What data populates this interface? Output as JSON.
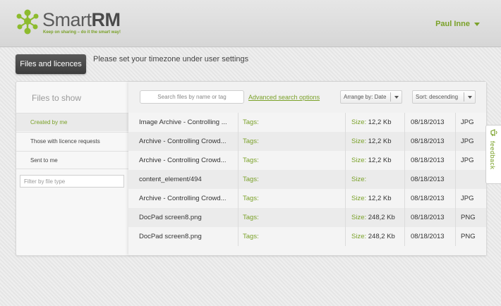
{
  "brand": {
    "name_part1": "Smart",
    "name_part2": "RM",
    "tagline": "Keep on sharing – do it the smart way!",
    "accent_color": "#7aa128"
  },
  "header": {
    "user_name": "Paul Inne"
  },
  "top_button": "Files and licences",
  "notice": "Please set your timezone under user settings",
  "sidebar": {
    "title": "Files to show",
    "items": [
      {
        "label": "Created by me",
        "active": true
      },
      {
        "label": "Those with licence requests",
        "active": false
      },
      {
        "label": "Sent to me",
        "active": false
      }
    ],
    "filter_placeholder": "Filter by file type"
  },
  "toolbar": {
    "search_placeholder": "Search files by name or tag",
    "advanced_link": "Advanced search options",
    "arrange_label": "Arrange by: Date",
    "sort_label": "Sort: descending"
  },
  "labels": {
    "tags": "Tags:",
    "size": "Size:"
  },
  "files": [
    {
      "name": "Image Archive - Controlling ...",
      "size": "12,2 Kb",
      "date": "08/18/2013",
      "ext": "JPG"
    },
    {
      "name": "Archive - Controlling Crowd...",
      "size": "12,2 Kb",
      "date": "08/18/2013",
      "ext": "JPG"
    },
    {
      "name": "Archive - Controlling Crowd...",
      "size": "12,2 Kb",
      "date": "08/18/2013",
      "ext": "JPG"
    },
    {
      "name": "content_element/494",
      "size": "",
      "date": "08/18/2013",
      "ext": ""
    },
    {
      "name": "Archive - Controlling Crowd...",
      "size": "12,2 Kb",
      "date": "08/18/2013",
      "ext": "JPG"
    },
    {
      "name": "DocPad screen8.png",
      "size": "248,2 Kb",
      "date": "08/18/2013",
      "ext": "PNG"
    },
    {
      "name": "DocPad screen8.png",
      "size": "248,2 Kb",
      "date": "08/18/2013",
      "ext": "PNG"
    }
  ],
  "feedback": {
    "label": "feedback",
    "icon": "megaphone-icon"
  }
}
